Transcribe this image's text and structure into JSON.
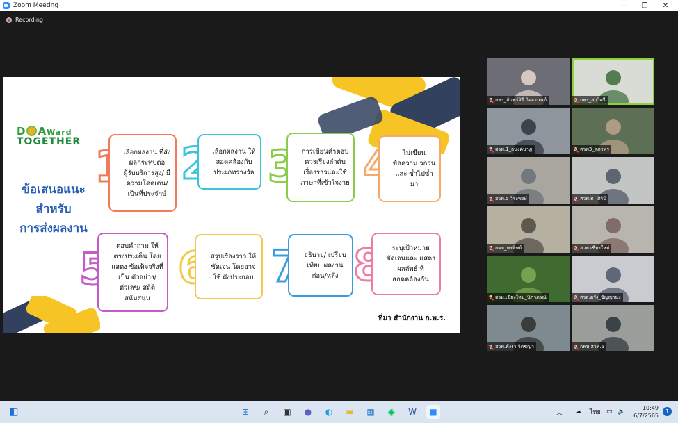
{
  "window": {
    "title": "Zoom Meeting",
    "minimize_glyph": "—",
    "restore_glyph": "❐",
    "close_glyph": "✕"
  },
  "recording": {
    "label": "Recording"
  },
  "slide": {
    "logo": {
      "line1_d": "D",
      "line1_a": "A",
      "line1_rest": "Ward",
      "line2": "TOGETHER"
    },
    "heading": [
      "ข้อเสนอแนะ",
      "สำหรับ",
      "การส่งผลงาน"
    ],
    "cards": [
      {
        "number": "1",
        "color": "#f07a5a",
        "text": "เลือกผลงาน ที่ส่งผลกระทบต่อ ผู้รับบริการสูง/ มีความโดดเด่น/ เป็นที่ประจักษ์"
      },
      {
        "number": "2",
        "color": "#3cc4dc",
        "text": "เลือกผลงาน ให้สอดคล้องกับ ประเภทรางวัล"
      },
      {
        "number": "3",
        "color": "#8ccc4c",
        "text": "การเขียนคำตอบ ควรเรียงลำดับ เรื่องราวและใช้ ภาษาที่เข้าใจง่าย"
      },
      {
        "number": "4",
        "color": "#f5a86a",
        "text": "ไม่เขียน ข้อความ วกวนและ ซ้ำไปซ้ำมา"
      },
      {
        "number": "5",
        "color": "#c45cc8",
        "text": "ตอบคำถาม ให้ตรงประเด็น โดยแสดง ข้อเท็จจริงที่เป็น ตัวอย่าง/ตัวเลข/ สถิติสนับสนุน"
      },
      {
        "number": "6",
        "color": "#f2c94c",
        "text": "สรุปเรื่องราว ให้ชัดเจน โดยอาจใช้ ผังประกอบ"
      },
      {
        "number": "7",
        "color": "#3c9ce0",
        "text": "อธิบาย/ เปรียบเทียบ ผลงานก่อน/หลัง"
      },
      {
        "number": "8",
        "color": "#f07aa8",
        "text": "ระบุเป้าหมาย ชัดเจนและ แสดงผลลัพธ์ ที่สอดคล้องกัน"
      }
    ],
    "source": "ที่มา สำนักงาน ก.พ.ร."
  },
  "participants": [
    {
      "name": "กพร_จันทร์จิรี กิจจานนท์",
      "bg": "#6d6e75",
      "fg": "#e9d7cf"
    },
    {
      "name": "กพร_สาวิตรี",
      "bg": "#d9dbd5",
      "fg": "#3c6b3a",
      "active": true
    },
    {
      "name": "สวพ.1_อนงค์นาฏ",
      "bg": "#8f959c",
      "fg": "#2d3540"
    },
    {
      "name": "สวพ3_สุภาพร",
      "bg": "#5d6f55",
      "fg": "#b9a48c"
    },
    {
      "name": "สวพ.5 วีระพงษ์",
      "bg": "#a9a6a0",
      "fg": "#6a6e78"
    },
    {
      "name": "สวพ.8 _ศิรินี",
      "bg": "#c3c5c4",
      "fg": "#4b5361"
    },
    {
      "name": "กคย_พรทิพย์",
      "bg": "#b6b0a0",
      "fg": "#4d4a40"
    },
    {
      "name": "สวพ.เชียงใหม่",
      "bg": "#b8b5ae",
      "fg": "#77605a"
    },
    {
      "name": "สวม.เชียงใหม่_นิภาภรณ์",
      "bg": "#3f6a30",
      "fg": "#7eab55"
    },
    {
      "name": "สวส.ตรัง_ชัญญามะ",
      "bg": "#c9cbd0",
      "fg": "#4e5668"
    },
    {
      "name": "สวพ.พังงา จิตชญา",
      "bg": "#7e8a8f",
      "fg": "#2f2f2f"
    },
    {
      "name": "กพป สวพ.5",
      "bg": "#9a9d9a",
      "fg": "#2c3438"
    }
  ],
  "taskbar": {
    "icons": [
      {
        "name": "start-icon",
        "glyph": "⊞",
        "color": "#1f6fd1"
      },
      {
        "name": "search-icon",
        "glyph": "⌕",
        "color": "#222222"
      },
      {
        "name": "task-view-icon",
        "glyph": "▣",
        "color": "#333333"
      },
      {
        "name": "teams-chat-icon",
        "glyph": "●",
        "color": "#5b5fc7"
      },
      {
        "name": "edge-icon",
        "glyph": "◐",
        "color": "#1c9be0"
      },
      {
        "name": "file-explorer-icon",
        "glyph": "▬",
        "color": "#e8b830"
      },
      {
        "name": "photos-icon",
        "glyph": "▦",
        "color": "#1e78c8"
      },
      {
        "name": "line-icon",
        "glyph": "◉",
        "color": "#06c755"
      },
      {
        "name": "word-icon",
        "glyph": "W",
        "color": "#2b579a"
      },
      {
        "name": "zoom-icon",
        "glyph": "■",
        "color": "#2d8cff"
      }
    ],
    "left_widget_glyph": "◧",
    "tray": {
      "chevron": "︿",
      "language": "ไทย",
      "display": "▭",
      "speaker": "🔈"
    },
    "time": "10:49",
    "date": "6/7/2565",
    "notifications": "1"
  }
}
